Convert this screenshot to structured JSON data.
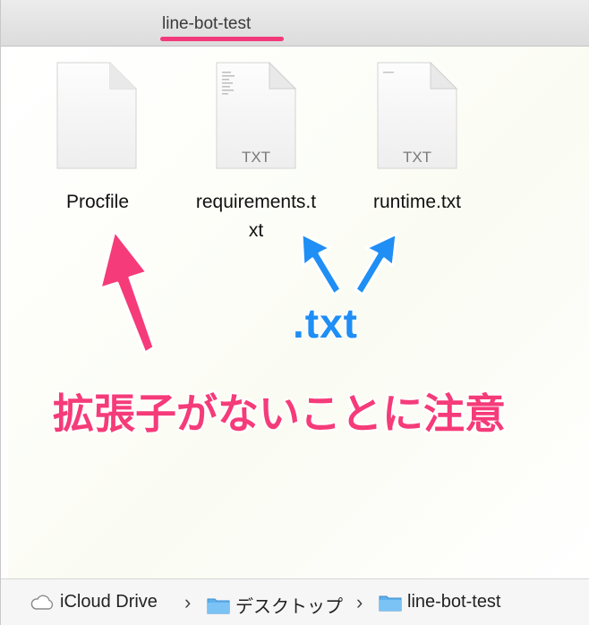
{
  "window": {
    "title": "line-bot-test"
  },
  "files": [
    {
      "name": "Procfile",
      "icon": "generic-document-icon",
      "badge": ""
    },
    {
      "name_line1": "requirements.t",
      "name_line2": "xt",
      "icon": "txt-document-icon",
      "badge": "TXT"
    },
    {
      "name": "runtime.txt",
      "icon": "txt-document-icon",
      "badge": "TXT"
    }
  ],
  "annotations": {
    "txt_label": ".txt",
    "warning": "拡張子がないことに注意",
    "pink": "#f53b79",
    "blue": "#1f8ef5"
  },
  "pathbar": {
    "items": [
      {
        "label": "iCloud Drive",
        "icon": "cloud-icon"
      },
      {
        "label": "デスクトップ",
        "icon": "folder-icon"
      },
      {
        "label": "line-bot-test",
        "icon": "folder-icon"
      }
    ],
    "separator": "›"
  }
}
